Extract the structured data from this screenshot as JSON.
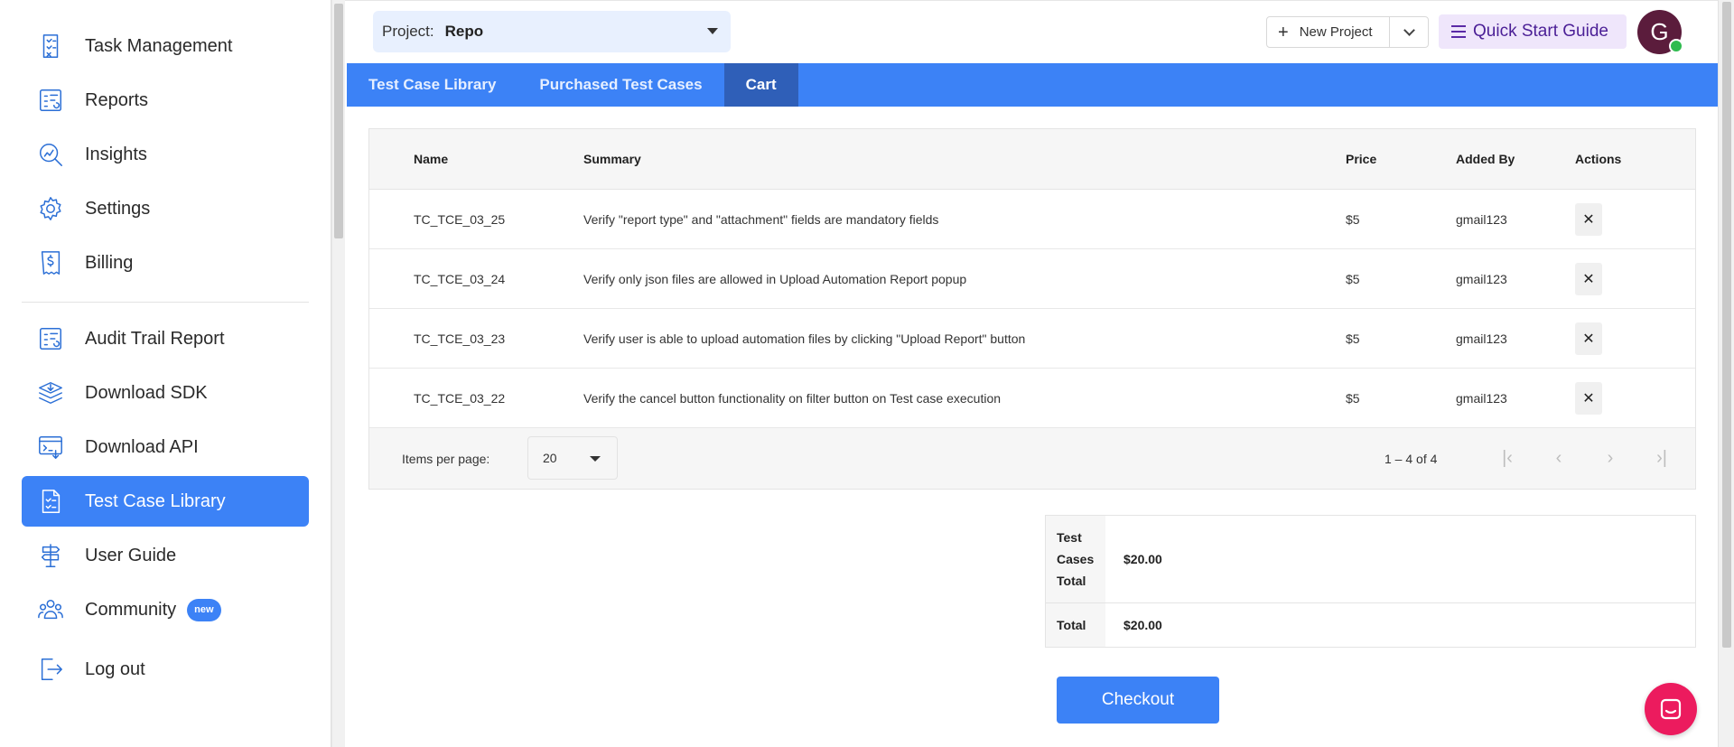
{
  "sidebar": {
    "items": [
      {
        "label": "Task Management",
        "icon": "task-checklist-icon"
      },
      {
        "label": "Reports",
        "icon": "report-chart-icon"
      },
      {
        "label": "Insights",
        "icon": "insights-magnifier-icon"
      },
      {
        "label": "Settings",
        "icon": "gear-icon"
      },
      {
        "label": "Billing",
        "icon": "billing-receipt-icon"
      },
      {
        "label": "Audit Trail Report",
        "icon": "audit-report-icon"
      },
      {
        "label": "Download SDK",
        "icon": "layers-download-icon"
      },
      {
        "label": "Download API",
        "icon": "api-download-icon"
      },
      {
        "label": "Test Case Library",
        "icon": "test-case-doc-icon"
      },
      {
        "label": "User Guide",
        "icon": "signpost-icon"
      },
      {
        "label": "Community",
        "icon": "people-group-icon",
        "badge": "new"
      },
      {
        "label": "Log out",
        "icon": "logout-icon"
      }
    ],
    "active_label": "Test Case Library"
  },
  "header": {
    "project_label": "Project:",
    "project_value": "Repo",
    "new_project_label": "New Project",
    "quick_start_label": "Quick Start Guide",
    "avatar_initial": "G"
  },
  "tabs": [
    {
      "label": "Test Case Library",
      "active": false
    },
    {
      "label": "Purchased Test Cases",
      "active": false
    },
    {
      "label": "Cart",
      "active": true
    }
  ],
  "table": {
    "columns": [
      "Name",
      "Summary",
      "Price",
      "Added By",
      "Actions"
    ],
    "rows": [
      {
        "name": "TC_TCE_03_25",
        "summary": "Verify \"report type\" and \"attachment\" fields are mandatory fields",
        "price": "$5",
        "added_by": "gmail123"
      },
      {
        "name": "TC_TCE_03_24",
        "summary": "Verify only json files are allowed in Upload Automation Report popup",
        "price": "$5",
        "added_by": "gmail123"
      },
      {
        "name": "TC_TCE_03_23",
        "summary": "Verify user is able to upload automation files by clicking \"Upload Report\" button",
        "price": "$5",
        "added_by": "gmail123"
      },
      {
        "name": "TC_TCE_03_22",
        "summary": "Verify the cancel button functionality on filter button on Test case execution",
        "price": "$5",
        "added_by": "gmail123"
      }
    ],
    "delete_glyph": "✕"
  },
  "paginator": {
    "items_per_page_label": "Items per page:",
    "page_size": "20",
    "range": "1 – 4 of 4"
  },
  "totals": {
    "test_cases_total_label": "Test Cases Total",
    "test_cases_total_value": "$20.00",
    "total_label": "Total",
    "total_value": "$20.00"
  },
  "checkout_label": "Checkout",
  "colors": {
    "primary": "#3c82f6",
    "active_tab": "#2f5fb8",
    "quick_start_bg": "#efe6fb",
    "avatar_bg": "#5b1c3c",
    "chat_launcher": "#ec1b5e"
  }
}
